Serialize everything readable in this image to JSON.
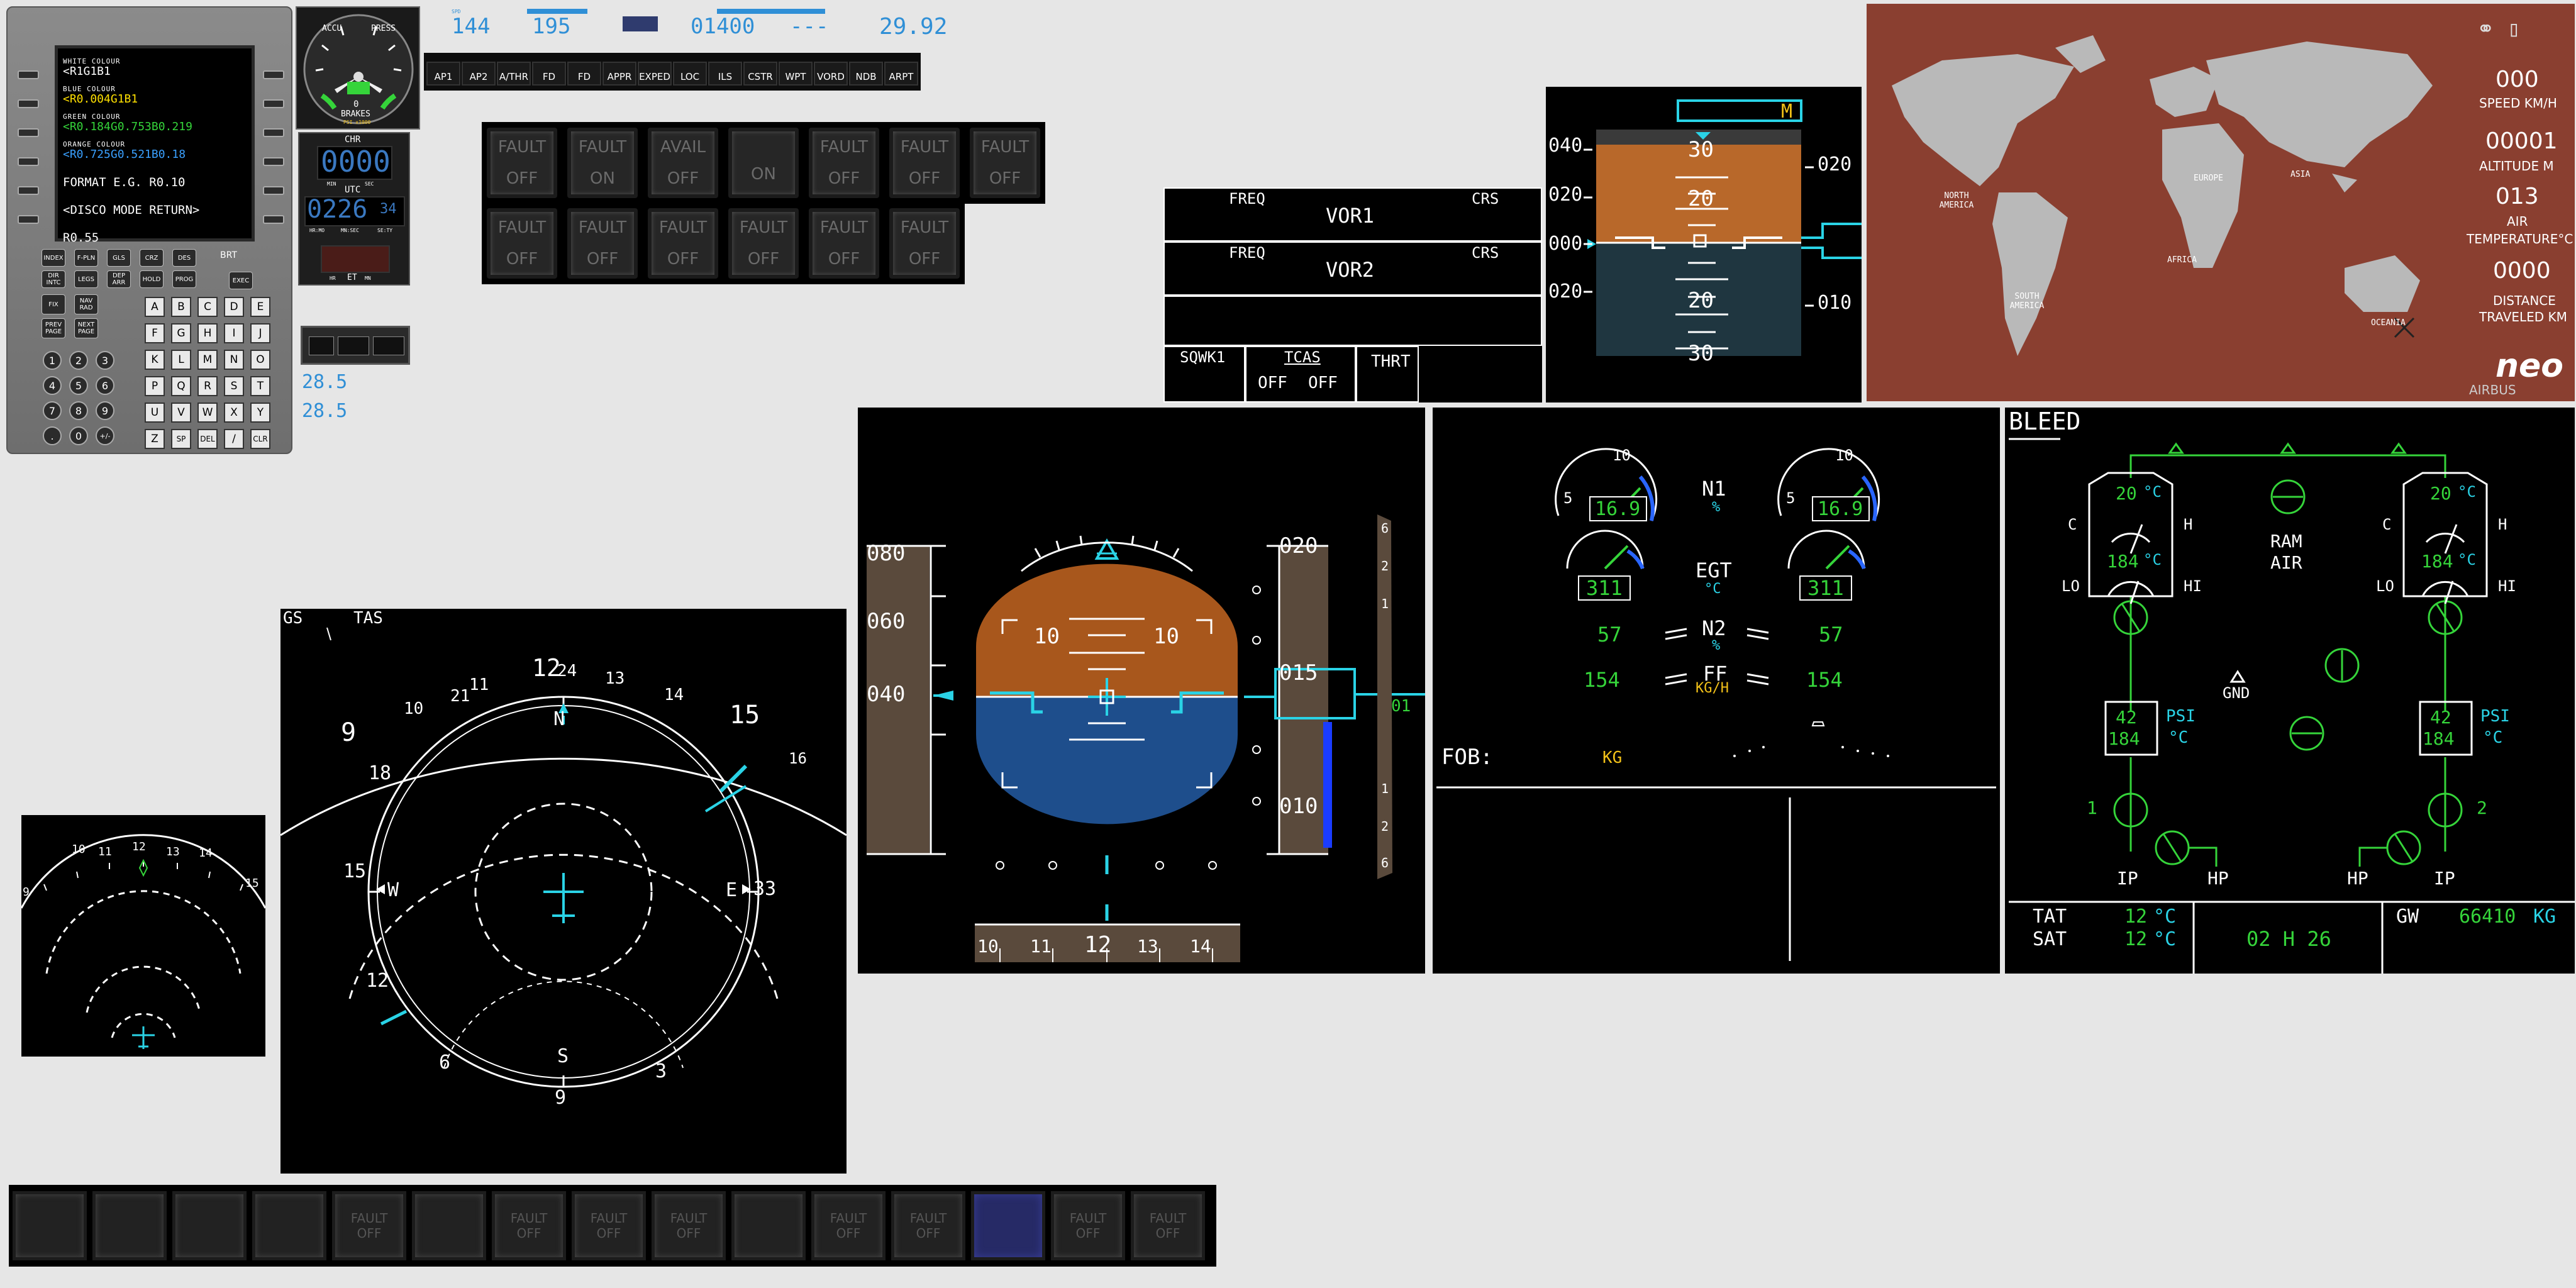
{
  "mcdu": {
    "lines": [
      {
        "small": "WHITE COLOUR",
        "big": "<R1G1B1",
        "color": "#ffffff"
      },
      {
        "small": "BLUE COLOUR",
        "big": "<R0.004G1B1",
        "color": "#ffe000"
      },
      {
        "small": "GREEN COLOUR",
        "big": "<R0.184G0.753B0.219",
        "color": "#35d43a"
      },
      {
        "small": "ORANGE COLOUR",
        "big": "<R0.725G0.521B0.18",
        "color": "#3aa0ff"
      },
      {
        "small": "",
        "big": "FORMAT E.G. R0.10",
        "color": "#ffffff"
      },
      {
        "small": "",
        "big": "<DISCO MODE      RETURN>",
        "color": "#ffffff"
      },
      {
        "small": "",
        "big": "R0.55",
        "color": "#ffffff"
      }
    ],
    "func_keys_row1": [
      "INDEX",
      "F-PLN",
      "GLS",
      "CRZ",
      "DES"
    ],
    "func_keys_row2": [
      "DIR INTC",
      "LEGS",
      "DEP ARR",
      "HOLD",
      "PROG"
    ],
    "func_keys_row3": [
      "FIX",
      "NAV RAD"
    ],
    "func_keys_row4": [
      "PREV PAGE",
      "NEXT PAGE"
    ],
    "brt_label": "BRT",
    "exec_label": "EXEC",
    "letters": [
      "A",
      "B",
      "C",
      "D",
      "E",
      "F",
      "G",
      "H",
      "I",
      "J",
      "K",
      "L",
      "M",
      "N",
      "O",
      "P",
      "Q",
      "R",
      "S",
      "T",
      "U",
      "V",
      "W",
      "X",
      "Y",
      "Z",
      "SP",
      "DEL",
      "/",
      "CLR"
    ],
    "digits": [
      "1",
      "2",
      "3",
      "4",
      "5",
      "6",
      "7",
      "8",
      "9",
      ".",
      "0",
      "+/-"
    ]
  },
  "gauge": {
    "top_left": "ACCU",
    "top_right": "PRESS",
    "scale": [
      "0",
      "1",
      "2",
      "3",
      "3",
      "2",
      "1",
      "0"
    ],
    "bottom": "BRAKES",
    "bottom_sub": "PSI x1000",
    "zero": "0"
  },
  "clock": {
    "chr_label": "CHR",
    "chr_value": "0000",
    "min_label": "MIN",
    "sec_label": "SEC",
    "utc_label": "UTC",
    "utc_value": "0226",
    "utc_sec": "34",
    "hmo": "HR:MO",
    "mnsec": "MN:SEC",
    "sety": "SE:TY",
    "hr_label": "HR",
    "min2_label": "MN",
    "et_label": "ET"
  },
  "fcu_values": {
    "spd": "144",
    "hdg": "195",
    "alt": "01400",
    "vs": "---",
    "baro": "29.92",
    "small_lbl1": "SPD",
    "small_lbl2": "HDG",
    "small_lbl4": "ALT"
  },
  "fcu_buttons": [
    "AP1",
    "AP2",
    "A/THR",
    "FD",
    "FD",
    "APPR",
    "EXPED",
    "LOC",
    "ILS",
    "CSTR",
    "WPT",
    "VORD",
    "NDB",
    "ARPT"
  ],
  "radio_values": [
    "28.5",
    "28.5"
  ],
  "overhead_row1": [
    [
      "FAULT",
      "OFF"
    ],
    [
      "FAULT",
      "ON"
    ],
    [
      "AVAIL",
      "OFF"
    ],
    [
      "",
      "ON"
    ],
    [
      "FAULT",
      "OFF"
    ],
    [
      "FAULT",
      "OFF"
    ],
    [
      "FAULT",
      "OFF"
    ]
  ],
  "overhead_row2": [
    [
      "FAULT",
      "OFF"
    ],
    [
      "FAULT",
      "OFF"
    ],
    [
      "FAULT",
      "OFF"
    ],
    [
      "FAULT",
      "OFF"
    ],
    [
      "FAULT",
      "OFF"
    ],
    [
      "FAULT",
      "OFF"
    ]
  ],
  "rmp": {
    "freq1": "FREQ",
    "crs1": "CRS",
    "vor1": "VOR1",
    "freq2": "FREQ",
    "crs2": "CRS",
    "vor2": "VOR2",
    "sqwk": "SQWK1",
    "tcas": "TCAS",
    "off1": "OFF",
    "off2": "OFF",
    "thrt": "THRT"
  },
  "mini_pfd": {
    "hdg_box": "M",
    "ticks_left": [
      "040",
      "020",
      "000",
      "020"
    ],
    "ticks_right": [
      "020",
      "010"
    ],
    "pitch": [
      "30",
      "20",
      "20",
      "30"
    ]
  },
  "map": {
    "speed_value": "000",
    "speed_label": "SPEED KM/H",
    "alt_value": "00001",
    "alt_label": "ALTITUDE M",
    "temp_value": "013",
    "temp_label1": "AIR",
    "temp_label2": "TEMPERATURE°C",
    "dist_value": "0000",
    "dist_label1": "DISTANCE",
    "dist_label2": "TRAVELED KM",
    "continents": [
      "NORTH AMERICA",
      "SOUTH AMERICA",
      "EUROPE",
      "AFRICA",
      "ASIA",
      "OCEANIA"
    ],
    "brand1": "neo",
    "brand2": "AIRBUS",
    "bg": "#8a3f30"
  },
  "pfd": {
    "speed_ticks": [
      "080",
      "060",
      "040"
    ],
    "alt_ticks": [
      "020",
      "015",
      "010"
    ],
    "pitch_left": "10",
    "pitch_right": "10",
    "hdg_ticks": [
      "10",
      "11",
      "12",
      "13",
      "14"
    ],
    "vs_ticks": [
      "6",
      "2",
      "1",
      "1",
      "2",
      "6"
    ],
    "alt_box": "01"
  },
  "nd_small": {
    "ticks": [
      "10",
      "11",
      "12",
      "13",
      "14",
      "15",
      "9"
    ]
  },
  "nd": {
    "gs_label": "GS",
    "tas_label": "TAS",
    "outer": [
      "12",
      "24",
      "13",
      "15",
      "16",
      "9",
      "10",
      "11",
      "14",
      "21",
      "18",
      "6",
      "3",
      "33",
      "12"
    ],
    "n": "N",
    "e": "E",
    "s": "S",
    "w": "W",
    "s9": "9",
    "i15": "15",
    "i12": "12",
    "i6": "6",
    "i3": "3",
    "i33": "33",
    "i24": "24",
    "i21": "21"
  },
  "ewd": {
    "n1_label": "N1",
    "n1_unit": "%",
    "n1_left": "16.9",
    "n1_right": "16.9",
    "egt_label": "EGT",
    "egt_unit": "°C",
    "egt_left": "311",
    "egt_right": "311",
    "n2_label": "N2",
    "n2_unit": "%",
    "n2_left": "57",
    "n2_right": "57",
    "ff_label": "FF",
    "ff_unit": "KG/H",
    "ff_left": "154",
    "ff_right": "154",
    "fob_label": "FOB:",
    "fob_unit": "KG",
    "scale5": "5",
    "scale10": "10"
  },
  "sd": {
    "title": "BLEED",
    "left_temp": "20",
    "left_temp2": "184",
    "right_temp": "20",
    "right_temp2": "184",
    "deg": "°C",
    "c_lbl": "C",
    "h_lbl": "H",
    "lo_lbl": "LO",
    "hi_lbl": "HI",
    "ram_air1": "RAM",
    "ram_air2": "AIR",
    "gnd": "GND",
    "psi": "PSI",
    "psi_val": "42",
    "psi_temp": "184",
    "eng1": "1",
    "eng2": "2",
    "ip": "IP",
    "hp": "HP",
    "tat_label": "TAT",
    "tat_value": "12",
    "sat_label": "SAT",
    "sat_value": "12",
    "deg2": "°C",
    "time": "02 H 26",
    "gw_label": "GW",
    "gw_value": "66410",
    "gw_unit": "KG"
  },
  "bottom_buttons": [
    [
      "",
      ""
    ],
    [
      "",
      ""
    ],
    [
      "",
      ""
    ],
    [
      "",
      ""
    ],
    [
      "FAULT",
      "OFF"
    ],
    [
      "",
      ""
    ],
    [
      "FAULT",
      "OFF"
    ],
    [
      "FAULT",
      "OFF"
    ],
    [
      "FAULT",
      "OFF"
    ],
    [
      "",
      ""
    ],
    [
      "FAULT",
      "OFF"
    ],
    [
      "FAULT",
      "OFF"
    ],
    [
      "",
      ""
    ],
    [
      "FAULT",
      "OFF"
    ],
    [
      "FAULT",
      "OFF"
    ]
  ]
}
